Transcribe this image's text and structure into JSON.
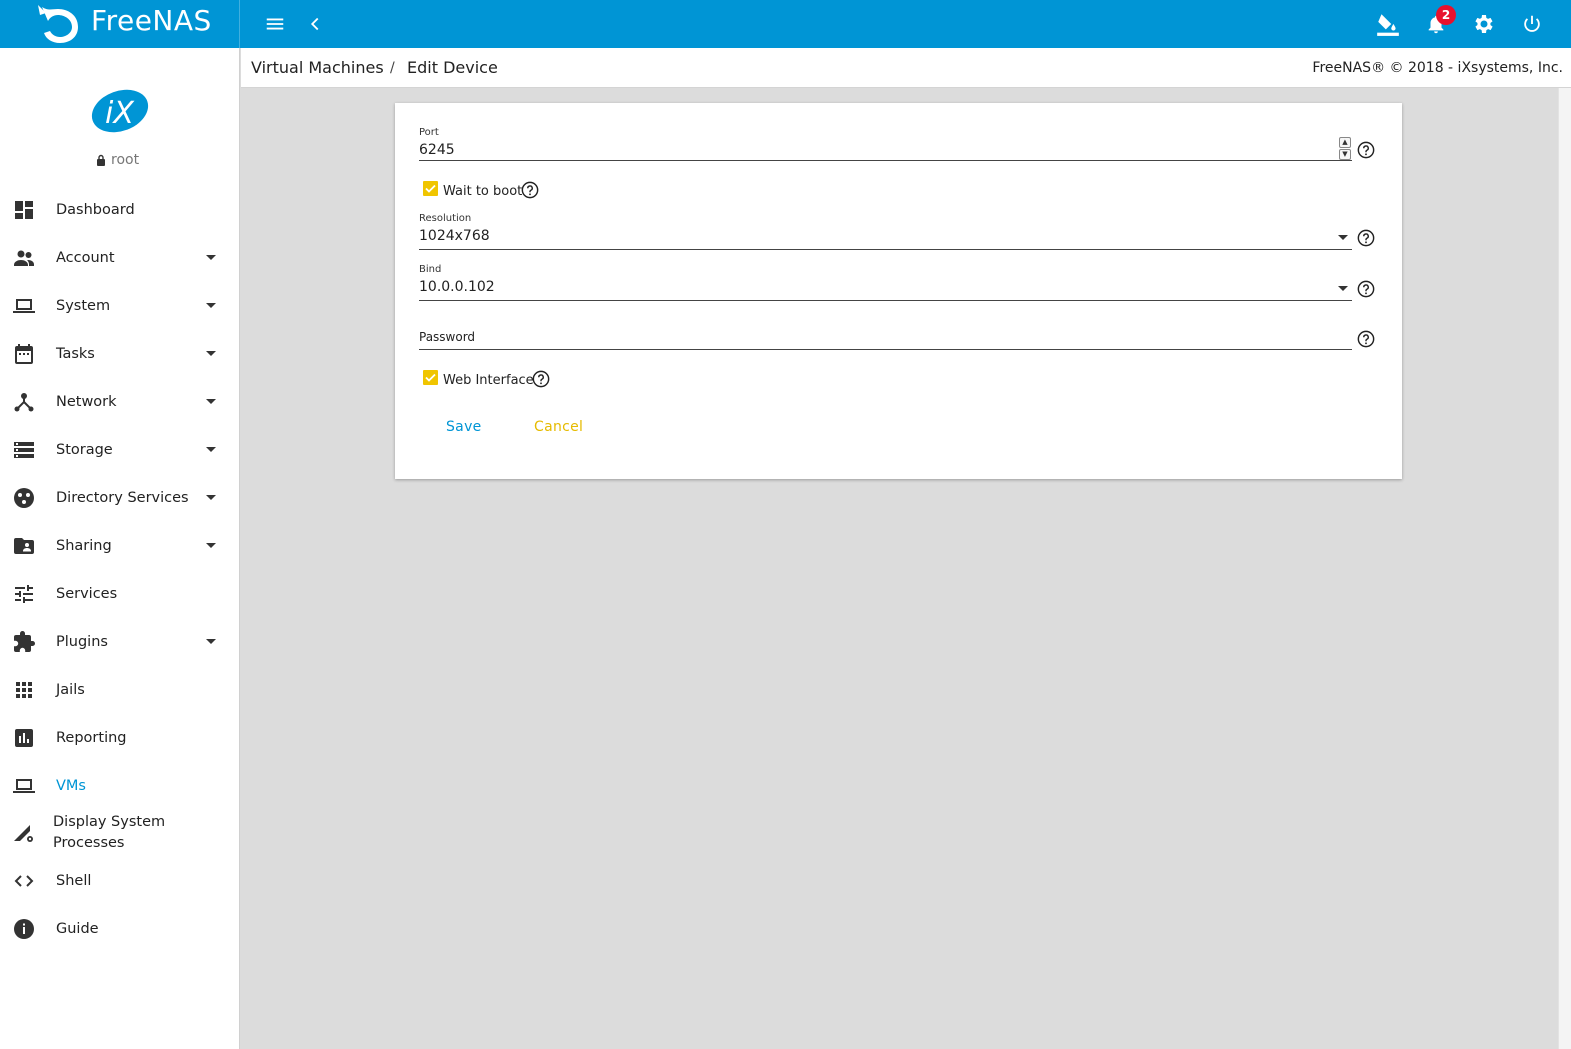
{
  "app": {
    "brand": "FreeNAS"
  },
  "header": {
    "notification_count": "2"
  },
  "user": {
    "name": "root"
  },
  "sidebar": {
    "items": [
      {
        "label": "Dashboard"
      },
      {
        "label": "Account"
      },
      {
        "label": "System"
      },
      {
        "label": "Tasks"
      },
      {
        "label": "Network"
      },
      {
        "label": "Storage"
      },
      {
        "label": "Directory Services"
      },
      {
        "label": "Sharing"
      },
      {
        "label": "Services"
      },
      {
        "label": "Plugins"
      },
      {
        "label": "Jails"
      },
      {
        "label": "Reporting"
      },
      {
        "label": "VMs"
      },
      {
        "label_line1": "Display System",
        "label_line2": "Processes"
      },
      {
        "label": "Shell"
      },
      {
        "label": "Guide"
      }
    ]
  },
  "breadcrumb": {
    "parent": "Virtual Machines",
    "separator": "/",
    "current": "Edit Device"
  },
  "copyright": "FreeNAS® © 2018 - iXsystems, Inc.",
  "form": {
    "port": {
      "label": "Port",
      "value": "6245"
    },
    "wait_to_boot": {
      "label": "Wait to boot",
      "checked": true
    },
    "resolution": {
      "label": "Resolution",
      "value": "1024x768"
    },
    "bind": {
      "label": "Bind",
      "value": "10.0.0.102"
    },
    "password": {
      "label": "Password",
      "value": ""
    },
    "web_interface": {
      "label": "Web Interface",
      "checked": true
    },
    "save_label": "Save",
    "cancel_label": "Cancel"
  },
  "colors": {
    "primary": "#0095d5",
    "accent": "#f0c500",
    "badge": "#e8112d"
  }
}
